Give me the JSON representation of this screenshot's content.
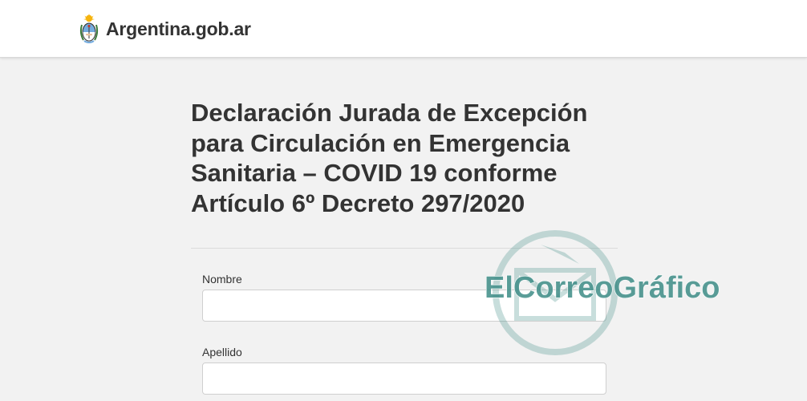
{
  "header": {
    "brand_text": "Argentina.gob.ar",
    "emblem_icon": "argentina-coat-of-arms-icon",
    "emblem_colors": {
      "sky_blue": "#74acdf",
      "white": "#ffffff",
      "sun": "#f6b40e",
      "dark": "#3a3a3a"
    }
  },
  "main": {
    "title": "Declaración Jurada de Excepción para Circulación en Emergencia Sanitaria – COVID 19 conforme Artículo 6º Decreto 297/2020"
  },
  "form": {
    "fields": [
      {
        "label": "Nombre",
        "value": "",
        "placeholder": ""
      },
      {
        "label": "Apellido",
        "value": "",
        "placeholder": ""
      }
    ]
  },
  "watermark": {
    "text": "ElCorreoGráfico",
    "icon": "envelope-circle-icon",
    "color": "#3d8c86"
  }
}
